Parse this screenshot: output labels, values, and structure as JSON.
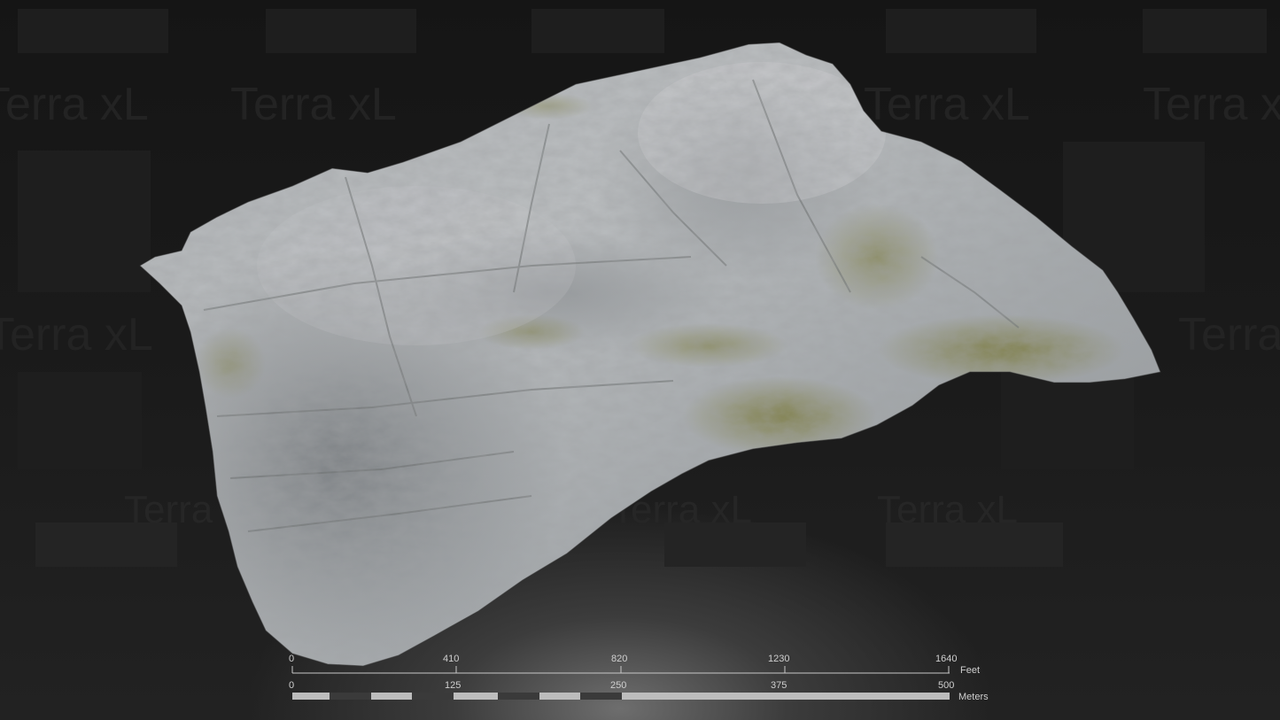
{
  "watermark": {
    "brand_text": "Terra xL"
  },
  "terrain": {
    "description_icon": "terrain-model-icon",
    "colors": {
      "rock_light": "#b9bcbe",
      "rock_mid": "#9ea2a5",
      "rock_dark": "#6f7377",
      "vegetation": "#7a7a3e",
      "background": "#151515"
    }
  },
  "scale": {
    "feet": {
      "unit": "Feet",
      "ticks": [
        "0",
        "410",
        "820",
        "1230",
        "1640"
      ]
    },
    "meters": {
      "unit": "Meters",
      "ticks": [
        "0",
        "125",
        "250",
        "375",
        "500"
      ]
    }
  }
}
